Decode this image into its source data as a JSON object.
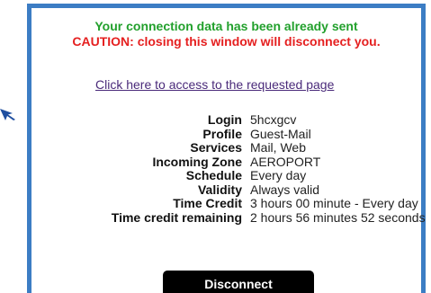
{
  "status": {
    "sent_message": "Your connection data has been already sent",
    "caution_message": "CAUTION: closing this window will disconnect you."
  },
  "link": {
    "access_text": "Click here to access to the requested page"
  },
  "info": [
    {
      "label": "Login",
      "value": "5hcxgcv"
    },
    {
      "label": "Profile",
      "value": "Guest-Mail"
    },
    {
      "label": "Services",
      "value": "Mail, Web"
    },
    {
      "label": "Incoming Zone",
      "value": "AEROPORT"
    },
    {
      "label": "Schedule",
      "value": "Every day"
    },
    {
      "label": "Validity",
      "value": "Always valid"
    },
    {
      "label": "Time Credit",
      "value": "3 hours 00 minute - Every day"
    },
    {
      "label": "Time credit remaining",
      "value": "2 hours 56 minutes 52 seconds"
    }
  ],
  "actions": {
    "disconnect_label": "Disconnect"
  },
  "colors": {
    "border": "#3c7dc4",
    "success": "#22a02c",
    "caution": "#e52020",
    "link": "#4a2a7a",
    "button": "#000000"
  }
}
